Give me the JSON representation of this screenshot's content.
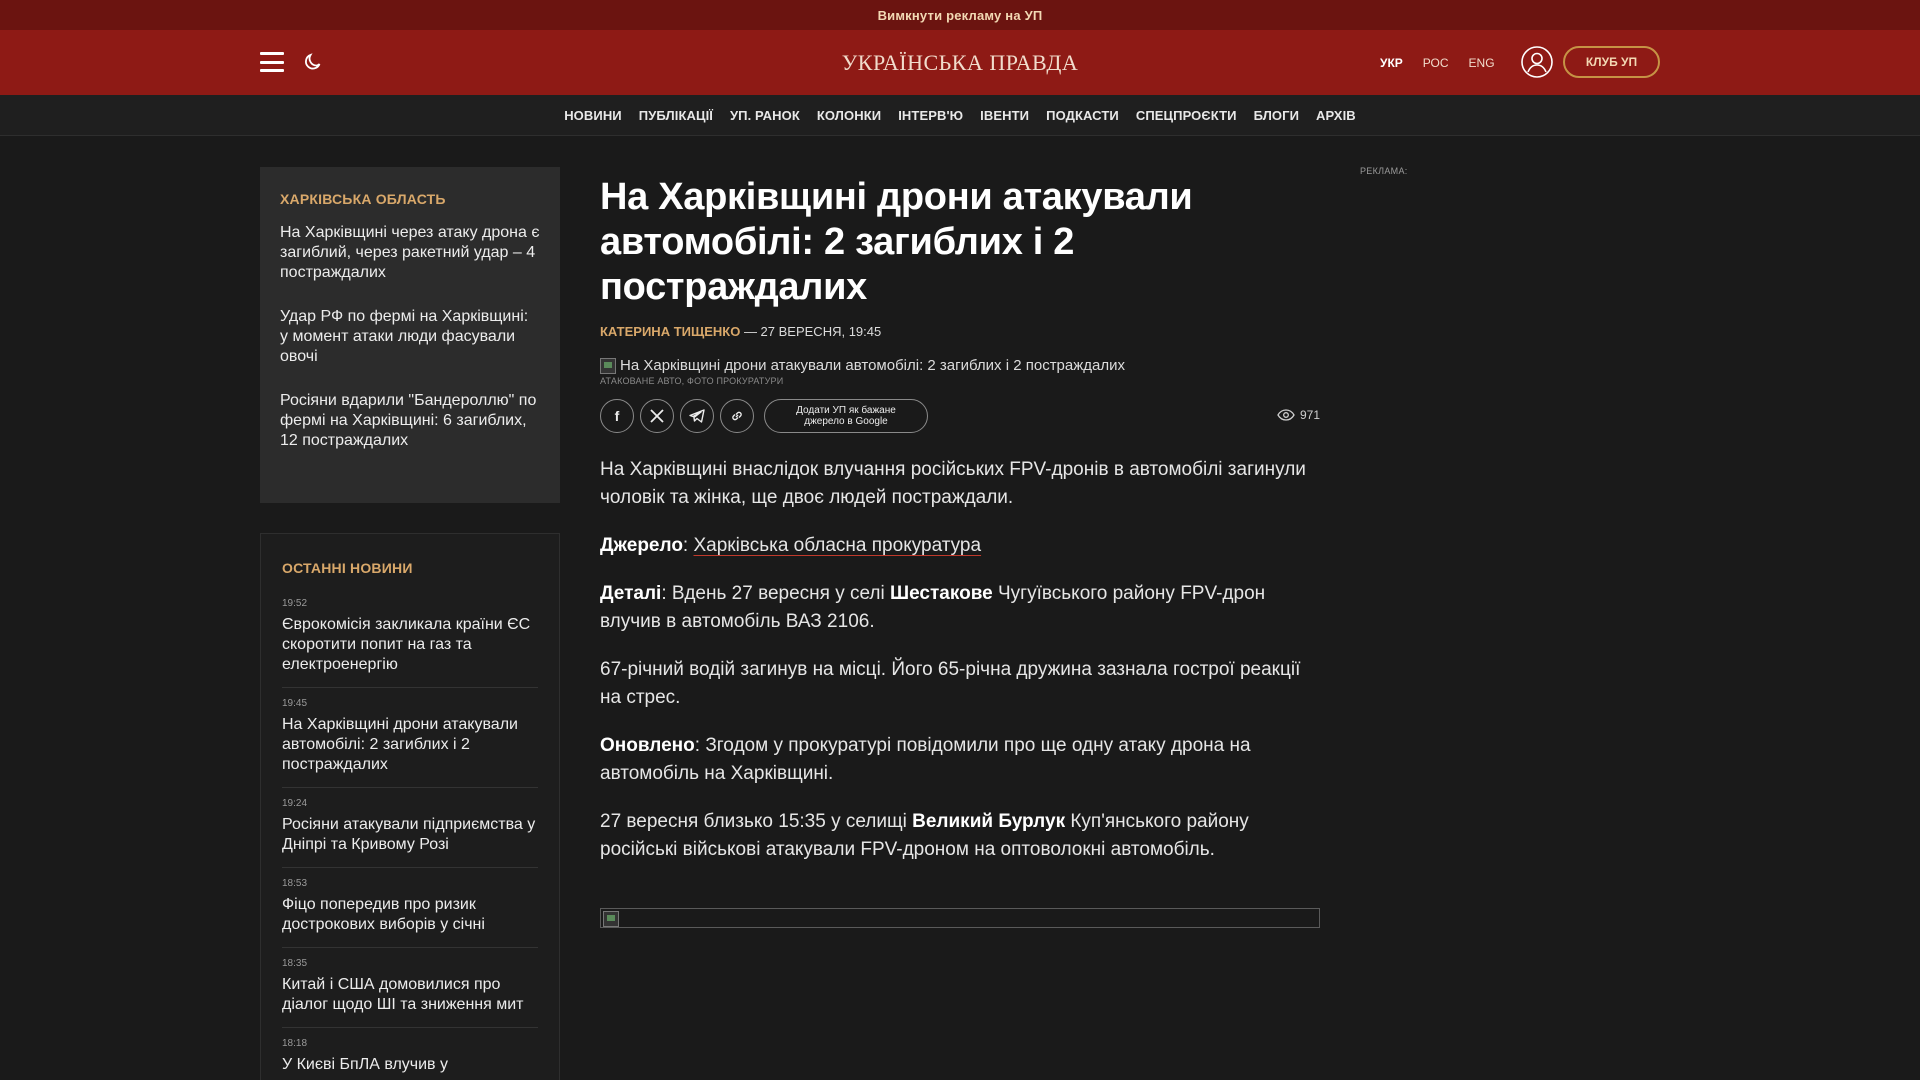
{
  "promo": {
    "text": "Вимкнути рекламу на УП"
  },
  "header": {
    "logo_text": "УКРАЇНСЬКА ПРАВДА",
    "languages": [
      {
        "label": "УКР",
        "active": true
      },
      {
        "label": "РОС",
        "active": false
      },
      {
        "label": "ENG",
        "active": false
      }
    ],
    "club_button": "КЛУБ УП",
    "icons": {
      "menu": "hamburger-menu-icon",
      "theme": "moon-icon",
      "user": "user-icon"
    },
    "colors": {
      "header_bg": "#8e1a15",
      "promo_bg": "#6b1410",
      "accent": "#d9a86a"
    }
  },
  "nav": {
    "items": [
      "НОВИНИ",
      "ПУБЛІКАЦІЇ",
      "УП. РАНОК",
      "КОЛОНКИ",
      "ІНТЕРВ'Ю",
      "ІВЕНТИ",
      "ПОДКАСТИ",
      "СПЕЦПРОЄКТИ",
      "БЛОГИ",
      "АРХІВ"
    ]
  },
  "region": {
    "heading": "ХАРКІВСЬКА ОБЛАСТЬ",
    "items": [
      "На Харківщині через атаку дрона є загиблий, через ракетний удар – 4 постраждалих",
      "Удар РФ по фермі на Харківщині: у момент атаки люди фасували овочі",
      "Росіяни вдарили \"Бандероллю\" по фермі на Харківщині: 6 загиблих, 12 постраждалих"
    ]
  },
  "latest": {
    "heading": "ОСТАННІ НОВИНИ",
    "items": [
      {
        "time": "19:52",
        "title": "Єврокомісія закликала країни ЄС скоротити попит на газ та електроенергію"
      },
      {
        "time": "19:45",
        "title": "На Харківщині дрони атакували автомобілі: 2 загиблих і 2 постраждалих"
      },
      {
        "time": "19:24",
        "title": "Росіяни атакували підприємства у Дніпрі та Кривому Розі"
      },
      {
        "time": "18:53",
        "title": "Фіцо попередив про ризик дострокових виборів у січні"
      },
      {
        "time": "18:35",
        "title": "Китай і США домовилися про діалог щодо ШІ та зниження мит"
      },
      {
        "time": "18:18",
        "title": "У Києві БпЛА влучив у"
      }
    ]
  },
  "article": {
    "title": "На Харківщині дрони атакували автомобілі: 2 загиблих і 2 постраждалих",
    "author": "КАТЕРИНА ТИЩЕНКО",
    "date": " — 27 ВЕРЕСНЯ, 19:45",
    "image_alt": "На Харківщині дрони атакували автомобілі: 2 загиблих і 2 постраждалих",
    "caption": "АТАКОВАНЕ АВТО, ФОТО ПРОКУРАТУРИ",
    "share": {
      "facebook": "f",
      "google_button": "Додати УП як бажане джерело в Google",
      "views": "971"
    },
    "paragraphs": {
      "p1": "На Харківщині внаслідок влучання російських FPV-дронів в автомобілі загинули чоловік та жінка, ще двоє людей постраждали.",
      "source_label": "Джерело",
      "source_sep": ": ",
      "source_link": "Харківська обласна прокуратура",
      "details_label": "Деталі",
      "details_a": ": Вдень 27 вересня у селі ",
      "details_place": "Шестакове",
      "details_b": " Чугуївського району FPV-дрон влучив в автомобіль ВАЗ 2106.",
      "p4": "67-річний водій загинув на місці. Його 65-річна дружина зазнала гострої реакції на стрес.",
      "updated_label": "Оновлено",
      "updated_text": ": Згодом у прокуратурі повідомили про ще одну атаку дрона на автомобіль на Харківщині.",
      "p6_a": "27 вересня близько 15:35 у селищі ",
      "p6_place": "Великий Бурлук",
      "p6_b": " Куп'янського району російські військові атакували FPV-дроном на оптоволокні автомобіль."
    }
  },
  "ad": {
    "label": "РЕКЛАМА:"
  }
}
